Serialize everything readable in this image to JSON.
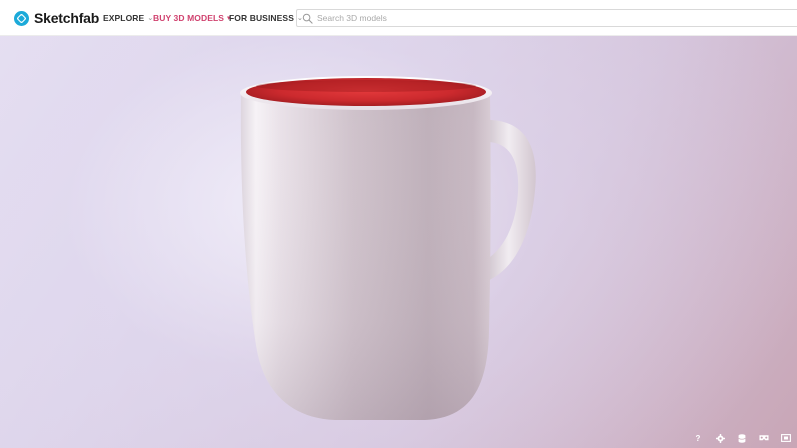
{
  "brand": {
    "name": "Sketchfab",
    "accent": "#1caad9"
  },
  "nav": {
    "items": [
      {
        "label": "EXPLORE",
        "icon": "chevron-down-icon"
      },
      {
        "label": "BUY 3D MODELS",
        "icon": "chevron-down-icon",
        "color": "#d0416e"
      },
      {
        "label": "FOR BUSINESS",
        "icon": "chevron-down-icon"
      }
    ]
  },
  "search": {
    "placeholder": "Search 3D models",
    "value": "",
    "icon": "search-icon"
  },
  "viewer": {
    "model": "mug",
    "mug_inner_color": "#c8262a",
    "controls": [
      {
        "name": "help-icon",
        "glyph": "?"
      },
      {
        "name": "settings-icon"
      },
      {
        "name": "layers-icon"
      },
      {
        "name": "vr-icon"
      },
      {
        "name": "fullscreen-icon"
      }
    ]
  }
}
